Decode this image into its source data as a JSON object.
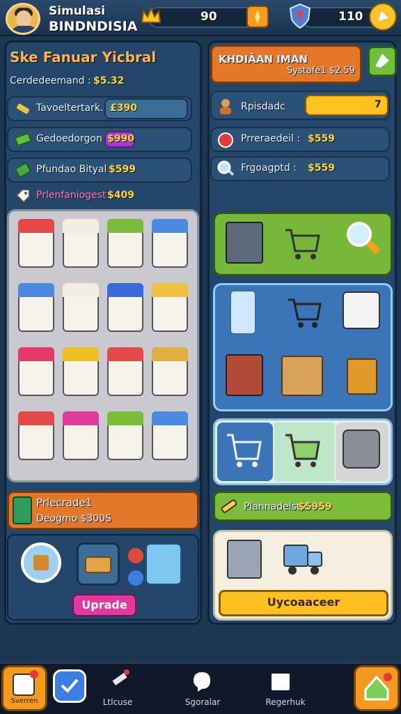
{
  "header": {
    "title_line1": "Simulasi",
    "title_line2": "BINDNDISIA",
    "coins": "90",
    "gems": "110"
  },
  "left_panel": {
    "title": "Ske Fanuar Yicbral",
    "subtitle_label": "Cerdedeemand :",
    "subtitle_value": "$5.32",
    "rows": [
      {
        "label": "Tavoeltertark.",
        "value": "£390"
      },
      {
        "label": "Gedoedorgon",
        "value": "$990"
      },
      {
        "label": "Pfundao Bityal :",
        "value": "$599"
      },
      {
        "label": "Prlenfaniogest",
        "value": "$409"
      }
    ],
    "promo_title": "Prlecrade1",
    "promo_sub": "Deogmo $300S",
    "upgrade_label": "Uprade"
  },
  "right_panel": {
    "header_title": "KHDIÃAN IMAN",
    "header_sub": "Systafe1 $2.59",
    "rows": [
      {
        "label": "Rpisdadc",
        "value": "7"
      },
      {
        "label": "Prreraedeil :",
        "value": "$559"
      },
      {
        "label": "Frgoagptd :",
        "value": "$559"
      }
    ],
    "promo_label": "Plannadelstal",
    "promo_value": "$5959",
    "action_label": "Uycoaaceer"
  },
  "bottom_nav": [
    {
      "label": "Sverren"
    },
    {
      "label": ""
    },
    {
      "label": "Ltlcuse"
    },
    {
      "label": "Sgoralar"
    },
    {
      "label": "Regerhuk"
    }
  ],
  "colors": {
    "accent_orange": "#e9732a",
    "accent_green": "#79c23a",
    "accent_yellow": "#ffd43b",
    "accent_pink": "#e23a9c"
  }
}
